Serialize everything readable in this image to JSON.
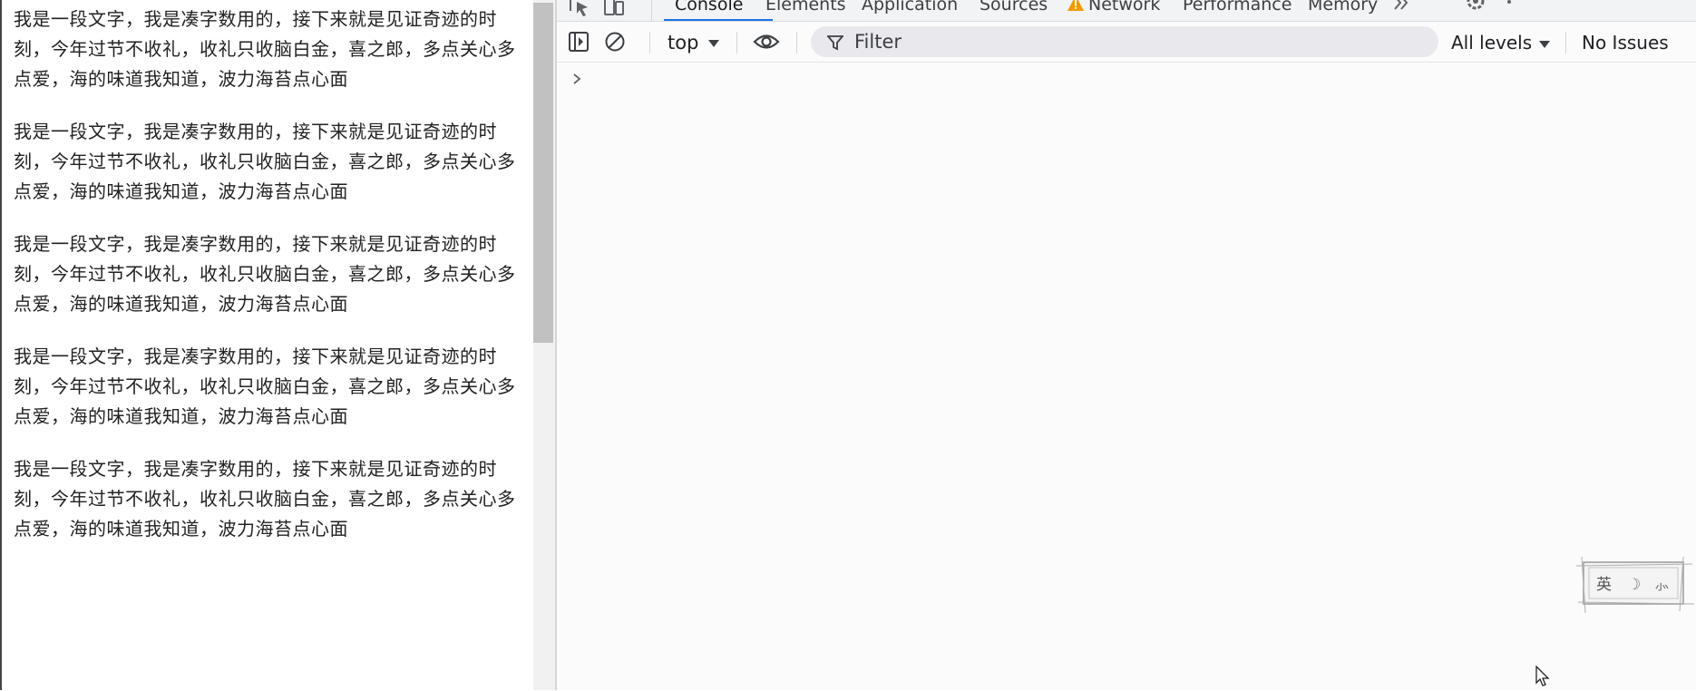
{
  "page": {
    "paragraphs": [
      "我是一段文字，我是凑字数用的，接下来就是见证奇迹的时刻，今年过节不收礼，收礼只收脑白金，喜之郎，多点关心多点爱，海的味道我知道，波力海苔点心面",
      "我是一段文字，我是凑字数用的，接下来就是见证奇迹的时刻，今年过节不收礼，收礼只收脑白金，喜之郎，多点关心多点爱，海的味道我知道，波力海苔点心面",
      "我是一段文字，我是凑字数用的，接下来就是见证奇迹的时刻，今年过节不收礼，收礼只收脑白金，喜之郎，多点关心多点爱，海的味道我知道，波力海苔点心面",
      "我是一段文字，我是凑字数用的，接下来就是见证奇迹的时刻，今年过节不收礼，收礼只收脑白金，喜之郎，多点关心多点爱，海的味道我知道，波力海苔点心面",
      "我是一段文字，我是凑字数用的，接下来就是见证奇迹的时刻，今年过节不收礼，收礼只收脑白金，喜之郎，多点关心多点爱，海的味道我知道，波力海苔点心面"
    ]
  },
  "devtools": {
    "tabs": [
      "Console",
      "Elements",
      "Application",
      "Sources",
      "Network",
      "Performance",
      "Memory"
    ],
    "active_tab": "Console",
    "network_warning_icon": "warning-triangle-icon",
    "toolbar": {
      "context": "top",
      "filter_placeholder": "Filter",
      "levels": "All levels",
      "issues": "No Issues"
    },
    "colors": {
      "accent": "#1a73e8",
      "warning": "#f29900"
    }
  },
  "ime_badge": {
    "labels": [
      "英",
      "☽",
      "⺗"
    ]
  }
}
